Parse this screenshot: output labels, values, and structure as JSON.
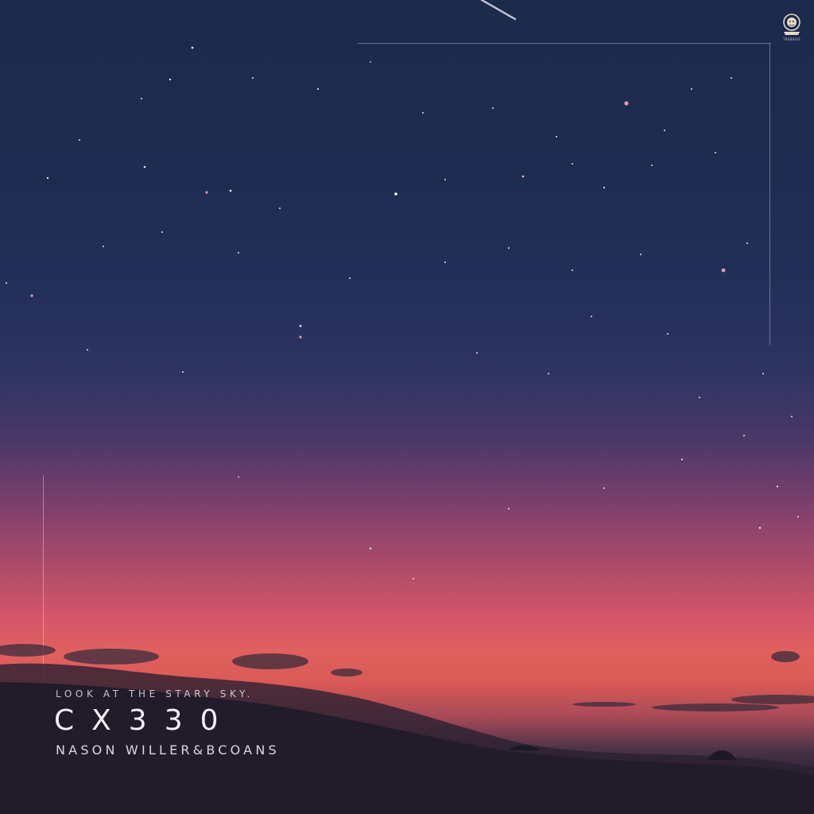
{
  "cover": {
    "subtitle": "LOOK AT THE STARY SKY.",
    "title": "CX330",
    "artist": "NASON WILLER&BCOANS"
  },
  "logo": {
    "icon": "lion-crest-icon",
    "label": "TRABASIS"
  },
  "colors": {
    "sky_top": "#1c2a4b",
    "sky_horizon": "#e0605e",
    "text": "#f1f1f6"
  }
}
